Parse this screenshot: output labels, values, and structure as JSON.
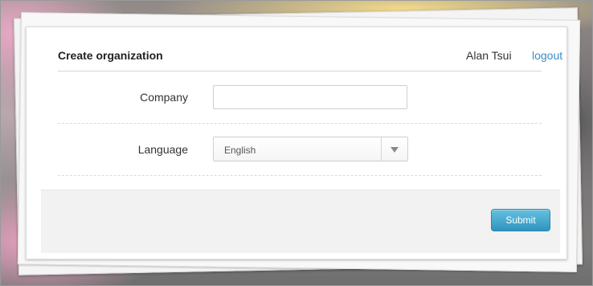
{
  "header": {
    "title": "Create organization",
    "user_name": "Alan Tsui",
    "logout_label": "logout"
  },
  "form": {
    "company": {
      "label": "Company",
      "value": "",
      "placeholder": ""
    },
    "language": {
      "label": "Language",
      "selected": "English"
    }
  },
  "footer": {
    "submit_label": "Submit"
  },
  "colors": {
    "link": "#3a8ec7",
    "button": "#2f95bf"
  }
}
